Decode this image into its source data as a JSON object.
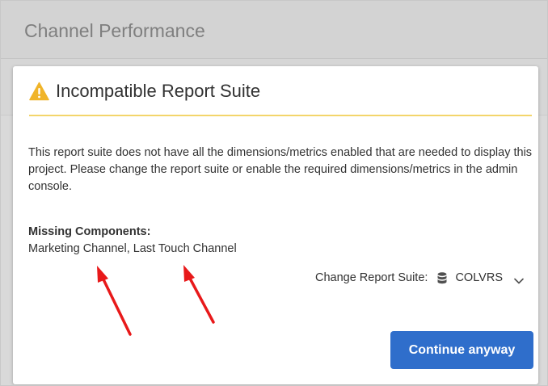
{
  "background": {
    "page_title": "Channel Performance"
  },
  "dialog": {
    "icon": "warning-icon",
    "title": "Incompatible Report Suite",
    "message": "This report suite does not have all the dimensions/metrics enabled that are needed to display this project. Please change the report suite or enable the required dimensions/metrics in the admin console.",
    "missing_label": "Missing Components:",
    "missing_value": "Marketing Channel, Last Touch Channel",
    "change_suite_label": "Change Report Suite:",
    "suite_icon": "database-icon",
    "suite_value": "COLVRS",
    "continue_label": "Continue anyway"
  },
  "colors": {
    "accent_button": "#2f6ecb",
    "warning": "#f0b429",
    "header_rule": "#f3d56b",
    "annotation_arrow": "#e8191a"
  }
}
